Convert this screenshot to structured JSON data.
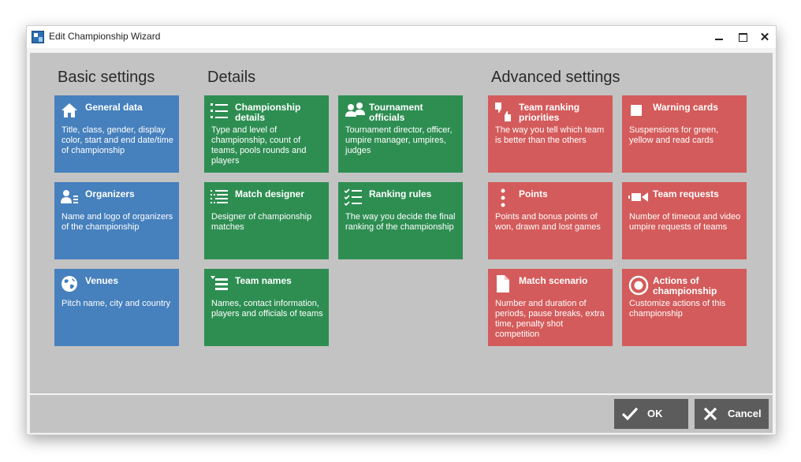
{
  "window": {
    "title": "Edit Championship Wizard"
  },
  "sections": {
    "basic": "Basic settings",
    "details": "Details",
    "advanced": "Advanced settings"
  },
  "tiles": {
    "general_data": {
      "title": "General data",
      "desc": "Title, class, gender, display color, start and end date/time of championship",
      "icon": "house-icon"
    },
    "organizers": {
      "title": "Organizers",
      "desc": "Name and logo of organizers of the championship",
      "icon": "person-list-icon"
    },
    "venues": {
      "title": "Venues",
      "desc": "Pitch name, city and country",
      "icon": "globe-icon"
    },
    "championship_details": {
      "title": "Championship details",
      "desc": "Type and level of championship, count of teams, pools rounds and players",
      "icon": "bullet-list-icon"
    },
    "match_designer": {
      "title": "Match designer",
      "desc": "Designer of championship matches",
      "icon": "dotted-list-icon"
    },
    "team_names": {
      "title": "Team names",
      "desc": "Names, contact information, players and officials of teams",
      "icon": "sort-list-icon"
    },
    "tournament_officials": {
      "title": "Tournament officials",
      "desc": "Tournament director, officer, umpire manager, umpires, judges",
      "icon": "people-icon"
    },
    "ranking_rules": {
      "title": "Ranking rules",
      "desc": "The way you decide the final ranking of the championship",
      "icon": "checklist-icon"
    },
    "team_ranking_priorities": {
      "title": "Team ranking priorities",
      "desc": "The way you tell which team is better than the others",
      "icon": "thumbs-icon"
    },
    "points": {
      "title": "Points",
      "desc": "Points and bonus points of won, drawn and lost games",
      "icon": "vertical-dots-icon"
    },
    "match_scenario": {
      "title": "Match scenario",
      "desc": "Number and duration of periods, pause breaks, extra time, penalty shot competition",
      "icon": "document-icon"
    },
    "warning_cards": {
      "title": "Warning cards",
      "desc": "Suspensions for green, yellow and read cards",
      "icon": "card-icon"
    },
    "team_requests": {
      "title": "Team requests",
      "desc": "Number of timeout and video umpire requests of teams",
      "icon": "video-camera-icon"
    },
    "actions_of_championship": {
      "title": "Actions of championship",
      "desc": "Customize actions of this championship",
      "icon": "radio-target-icon"
    }
  },
  "buttons": {
    "ok": "OK",
    "cancel": "Cancel"
  },
  "colors": {
    "basic": "#4680bd",
    "details": "#2e8e52",
    "advanced": "#d45b5b",
    "button": "#5c5c5c",
    "panel": "#c3c3c3"
  }
}
